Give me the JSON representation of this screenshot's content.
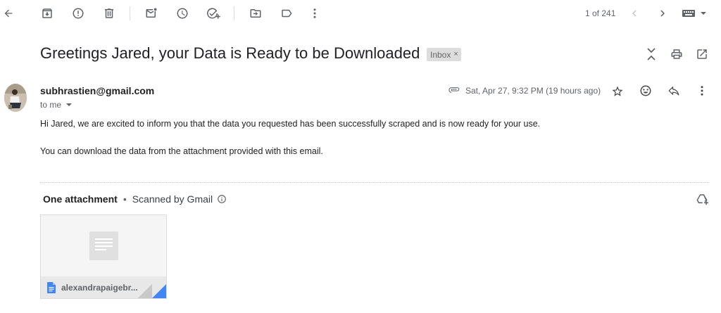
{
  "toolbar": {
    "back": "arrow-back-icon",
    "archive": "archive-icon",
    "report_spam": "report-spam-icon",
    "delete": "delete-icon",
    "mark_unread": "mark-unread-icon",
    "snooze": "snooze-icon",
    "add_task": "add-task-icon",
    "move_to": "move-to-icon",
    "labels": "label-icon",
    "more": "more-vert-icon",
    "pager": "1 of 241",
    "newer": "chevron-left-icon",
    "older": "chevron-right-icon",
    "input_tools": "keyboard-icon"
  },
  "email": {
    "subject": "Greetings Jared, your Data is Ready to be Downloaded",
    "label_chip": "Inbox",
    "label_chip_close": "×",
    "sender": "subhrastien@gmail.com",
    "recipient": "to me",
    "date": "Sat, Apr 27, 9:32 PM (19 hours ago)",
    "body": [
      "Hi Jared, we are excited to inform you that the data you requested has been successfully scraped and is now ready for your use.",
      "You can download the data from the attachment provided with this email."
    ]
  },
  "attachments": {
    "title": "One attachment",
    "separator": "•",
    "scanned": "Scanned by Gmail",
    "files": [
      {
        "name": "alexandrapaigebr...",
        "icon": "google-docs-icon"
      }
    ]
  },
  "colors": {
    "icon_grey": "#5f6368",
    "docs_blue": "#4285f4",
    "chip_bg": "#dddddd"
  }
}
